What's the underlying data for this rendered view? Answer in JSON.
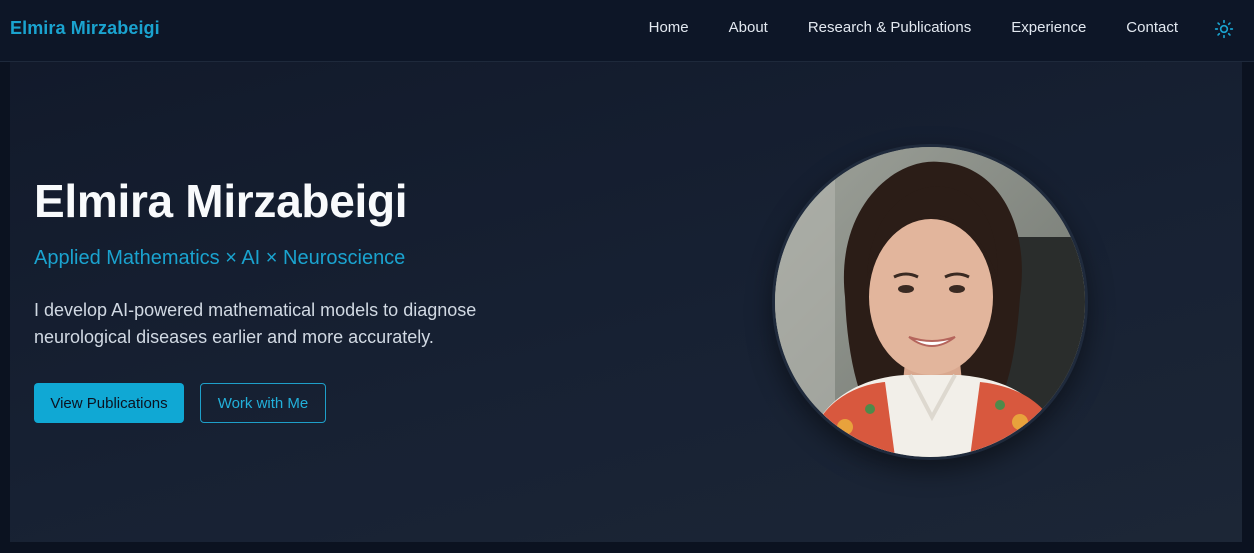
{
  "brand": "Elmira Mirzabeigi",
  "nav": {
    "items": [
      {
        "label": "Home"
      },
      {
        "label": "About"
      },
      {
        "label": "Research & Publications"
      },
      {
        "label": "Experience"
      },
      {
        "label": "Contact"
      }
    ],
    "theme_toggle_icon": "sun-icon"
  },
  "hero": {
    "title": "Elmira Mirzabeigi",
    "tagline": "Applied Mathematics × AI × Neuroscience",
    "description": "I develop AI-powered mathematical models to diagnose neurological diseases earlier and more accurately.",
    "primary_button": "View Publications",
    "secondary_button": "Work with Me",
    "portrait": "profile-photo"
  },
  "colors": {
    "accent": "#1aa3cf",
    "background": "#0b1220",
    "hero_background": "#172133",
    "text": "#f8fafc"
  }
}
